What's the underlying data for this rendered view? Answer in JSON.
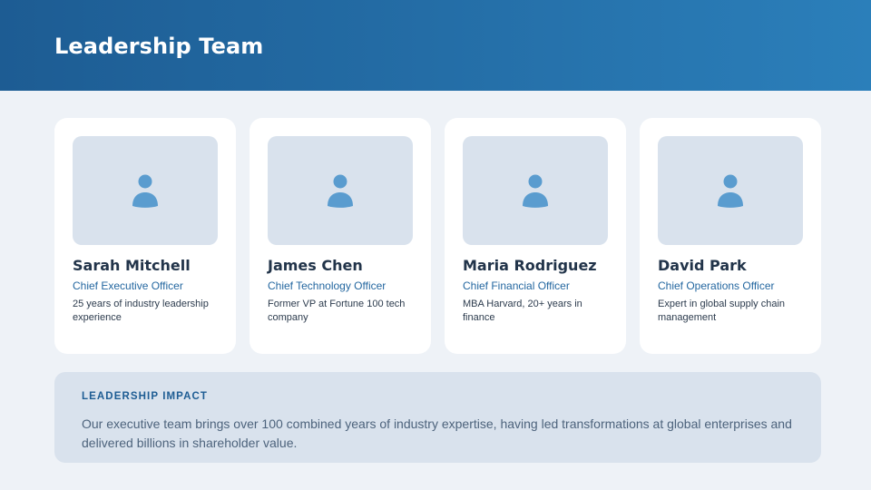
{
  "header": {
    "title": "Leadership Team"
  },
  "team": [
    {
      "name": "Sarah Mitchell",
      "role": "Chief Executive Officer",
      "bio": "25 years of industry leadership experience"
    },
    {
      "name": "James Chen",
      "role": "Chief Technology Officer",
      "bio": "Former VP at Fortune 100 tech company"
    },
    {
      "name": "Maria Rodriguez",
      "role": "Chief Financial Officer",
      "bio": "MBA Harvard, 20+ years in finance"
    },
    {
      "name": "David Park",
      "role": "Chief Operations Officer",
      "bio": "Expert in global supply chain management"
    }
  ],
  "impact": {
    "heading": "LEADERSHIP IMPACT",
    "text": "Our executive team brings over 100 combined years of industry expertise, having led transformations at global enterprises and delivered billions in shareholder value."
  },
  "icons": {
    "avatar": "person-icon"
  },
  "colors": {
    "header_start": "#1d5c93",
    "header_end": "#2b7fba",
    "accent": "#2467a0",
    "icon": "#5a9ccf",
    "background": "#eef2f7",
    "panel": "#d9e2ed"
  }
}
